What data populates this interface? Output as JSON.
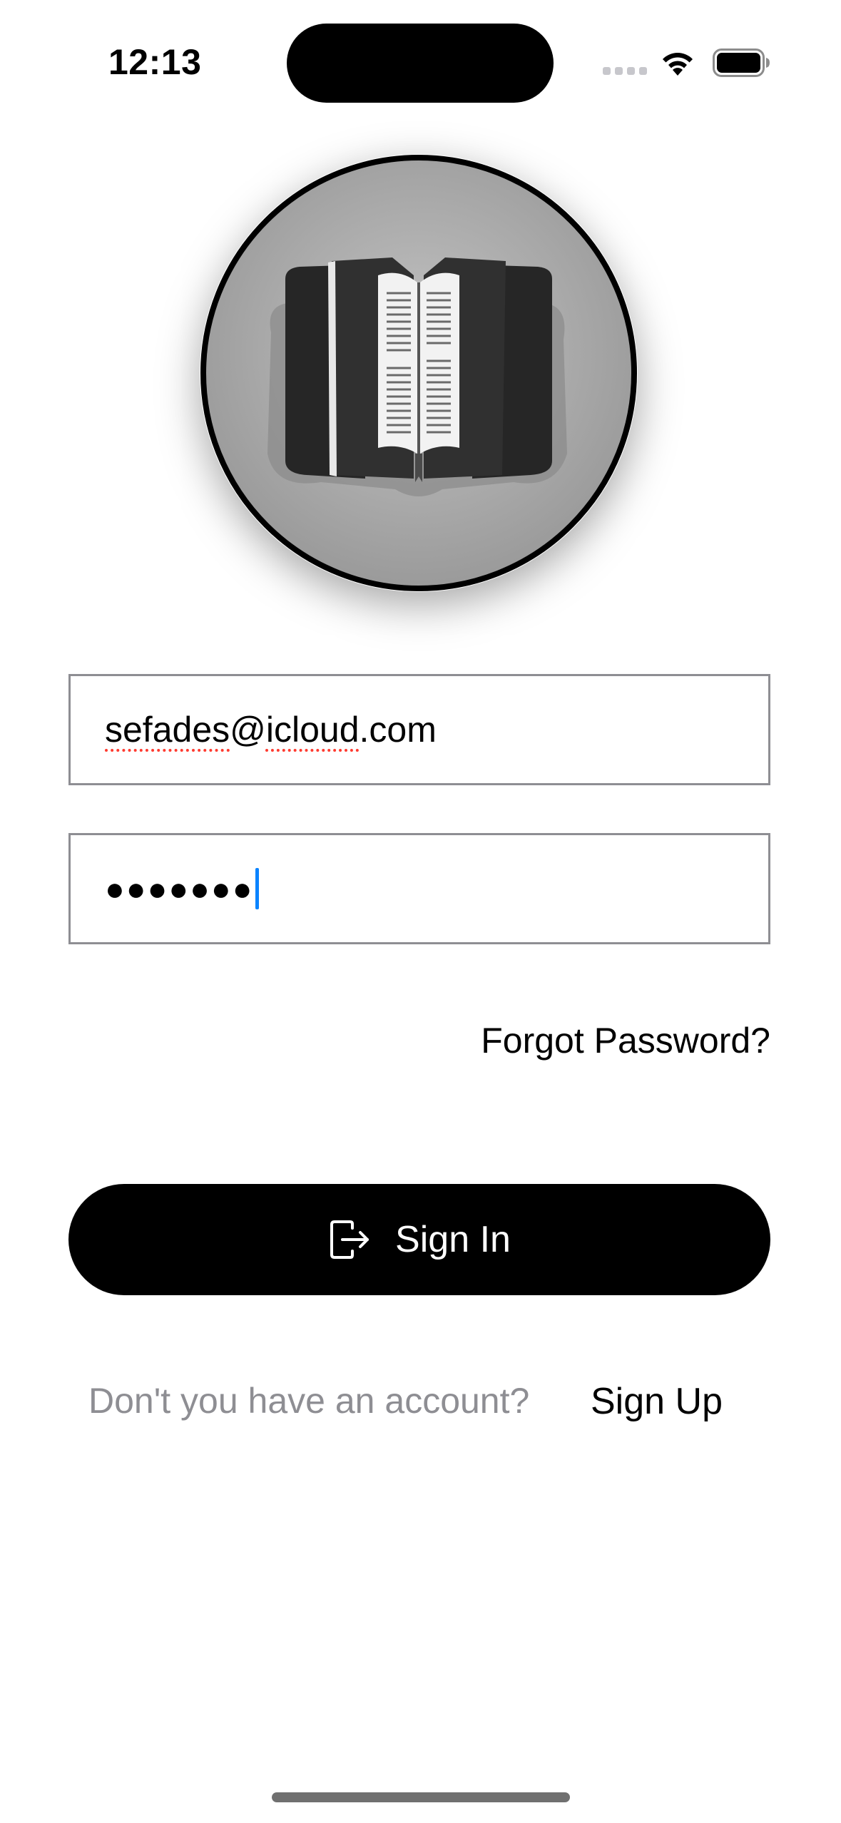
{
  "status_bar": {
    "time": "12:13"
  },
  "logo": {
    "icon": "open-book-icon"
  },
  "form": {
    "email_value": "sefades@icloud.com",
    "email_parts": [
      "sefades",
      "@",
      "icloud",
      ".com"
    ],
    "password_value": "●●●●●●●",
    "forgot_label": "Forgot Password?",
    "signin_label": "Sign In",
    "signin_icon": "sign-in-icon"
  },
  "footer": {
    "prompt": "Don't you have an account?",
    "signup_label": "Sign Up"
  },
  "colors": {
    "background": "#ffffff",
    "button": "#000000",
    "muted_text": "#8e8e93",
    "caret": "#0a84ff"
  }
}
